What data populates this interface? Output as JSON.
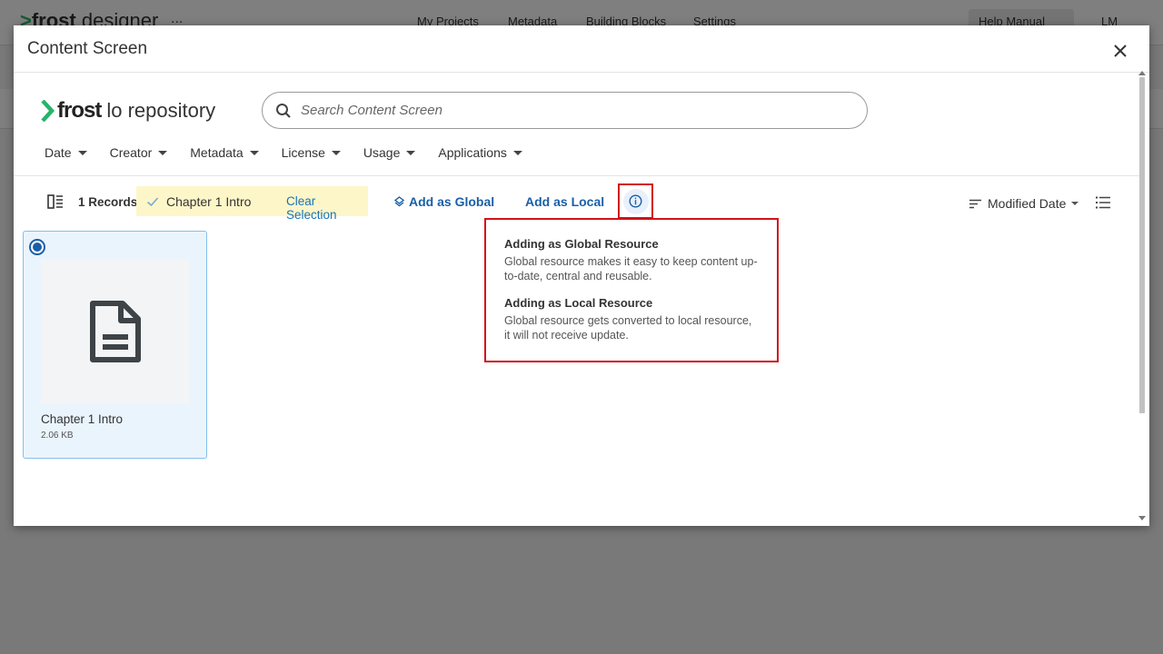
{
  "background_app": {
    "logo_brand": "frost",
    "logo_sub": "designer",
    "more": "...",
    "nav": [
      "My Projects",
      "Metadata",
      "Building Blocks",
      "Settings"
    ],
    "help": "Help Manual",
    "user": "LM"
  },
  "modal": {
    "title": "Content Screen",
    "close_icon": "close-icon"
  },
  "repository": {
    "brand": "frost",
    "sub": "lo repository"
  },
  "search": {
    "placeholder": "Search Content Screen",
    "value": ""
  },
  "filters": [
    "Date",
    "Creator",
    "Metadata",
    "License",
    "Usage",
    "Applications"
  ],
  "toolbar": {
    "records": "1 Records",
    "selected_item": "Chapter 1 Intro",
    "clear_selection": "Clear Selection",
    "add_global": "Add as Global",
    "add_local": "Add as Local",
    "sort_label": "Modified Date"
  },
  "info_tooltip": {
    "global_title": "Adding as Global Resource",
    "global_text": "Global resource makes it easy to keep content up-to-date, central and reusable.",
    "local_title": "Adding as Local Resource",
    "local_text": "Global resource gets converted to local resource, it will not receive update."
  },
  "items": [
    {
      "name": "Chapter 1 Intro",
      "size": "2.06 KB",
      "selected": true,
      "icon": "document-icon"
    }
  ],
  "colors": {
    "accent_blue": "#1a5fa8",
    "highlight_red": "#d0121b",
    "selection_yellow": "#fdf6c9",
    "brand_green": "#27b46a"
  }
}
